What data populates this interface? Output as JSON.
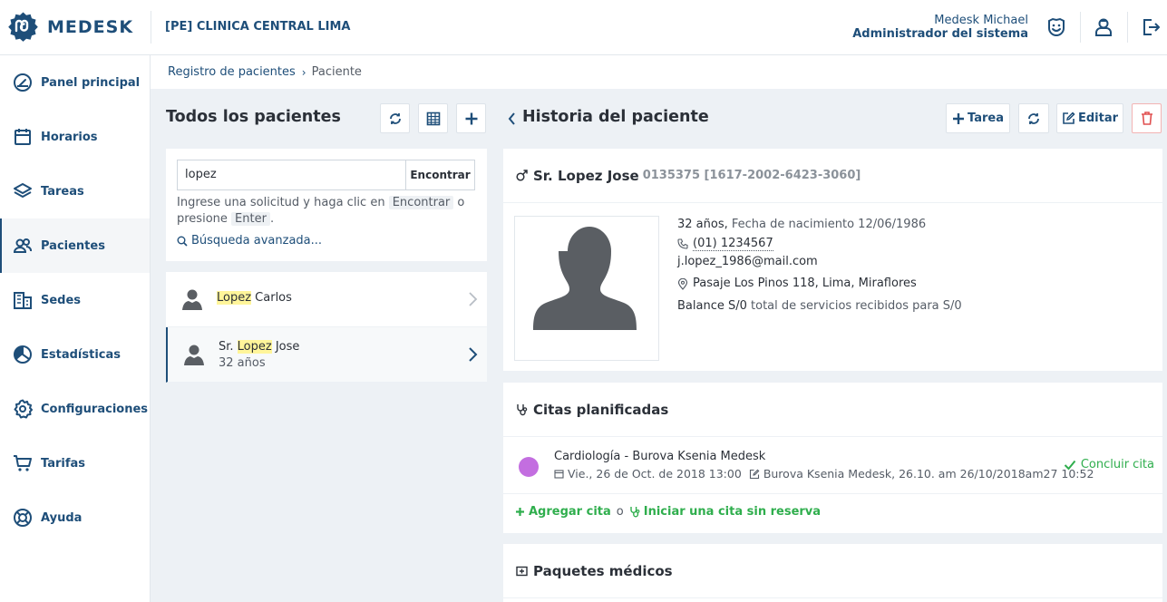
{
  "app": {
    "brand": "MEDESK",
    "clinic": "[PE] CLINICA CENTRAL LIMA"
  },
  "user": {
    "name": "Medesk Michael",
    "role": "Administrador del sistema"
  },
  "topbar_icons": [
    "smile-face-icon",
    "user-icon",
    "logout-icon"
  ],
  "sidebar": {
    "items": [
      {
        "label": "Panel principal",
        "icon": "dashboard-icon"
      },
      {
        "label": "Horarios",
        "icon": "calendar-icon"
      },
      {
        "label": "Tareas",
        "icon": "layers-icon"
      },
      {
        "label": "Pacientes",
        "icon": "users-icon",
        "active": true
      },
      {
        "label": "Sedes",
        "icon": "building-icon"
      },
      {
        "label": "Estadísticas",
        "icon": "pie-chart-icon"
      },
      {
        "label": "Configuraciones",
        "icon": "gear-icon"
      },
      {
        "label": "Tarifas",
        "icon": "cart-icon"
      },
      {
        "label": "Ayuda",
        "icon": "lifebuoy-icon"
      }
    ]
  },
  "breadcrumb": {
    "parent": "Registro de pacientes",
    "current": "Paciente"
  },
  "patients_panel": {
    "title": "Todos los pacientes",
    "search": {
      "value": "lopez",
      "button": "Encontrar",
      "hint_1": "Ingrese una solicitud y haga clic en",
      "hint_key_1": "Encontrar",
      "hint_2": "o presione",
      "hint_key_2": "Enter",
      "hint_3": ".",
      "advanced": "Búsqueda avanzada..."
    },
    "results": [
      {
        "prefix": "",
        "highlight": "Lopez",
        "rest": " Carlos",
        "age": ""
      },
      {
        "prefix": "Sr. ",
        "highlight": "Lopez",
        "rest": " Jose",
        "age": "32 años"
      }
    ]
  },
  "history": {
    "title": "Historia del paciente",
    "buttons": {
      "task": "Tarea",
      "edit": "Editar"
    },
    "patient": {
      "name": "Sr. Lopez Jose",
      "id": "0135375 [1617-2002-6423-3060]",
      "age": "32 años,",
      "birth": "Fecha de nacimiento 12/06/1986",
      "phone": "(01) 1234567",
      "email": "j.lopez_1986@mail.com",
      "address": "Pasaje Los Pinos 118, Lima, Miraflores",
      "balance": "Balance S/0",
      "services": "total de servicios recibidos para S/0"
    },
    "appointments": {
      "title": "Citas planificadas",
      "item": {
        "title": "Cardiología - Burova Ksenia Medesk",
        "date": "Vie., 26 de Oct. de 2018 13:00",
        "edited": "Burova Ksenia Medesk, 26.10. am 26/10/2018am27 10:52",
        "color": "#c36ee0",
        "action": "Concluir cita"
      },
      "add": "Agregar cita",
      "or": "o",
      "walk_in": "Iniciar una cita sin reserva"
    },
    "packages": {
      "title": "Paquetes médicos"
    }
  },
  "colors": {
    "brand": "#1e4e79",
    "success": "#2fae4d",
    "danger": "#e05050",
    "highlight": "#fff59a",
    "background": "#edf1f5"
  }
}
